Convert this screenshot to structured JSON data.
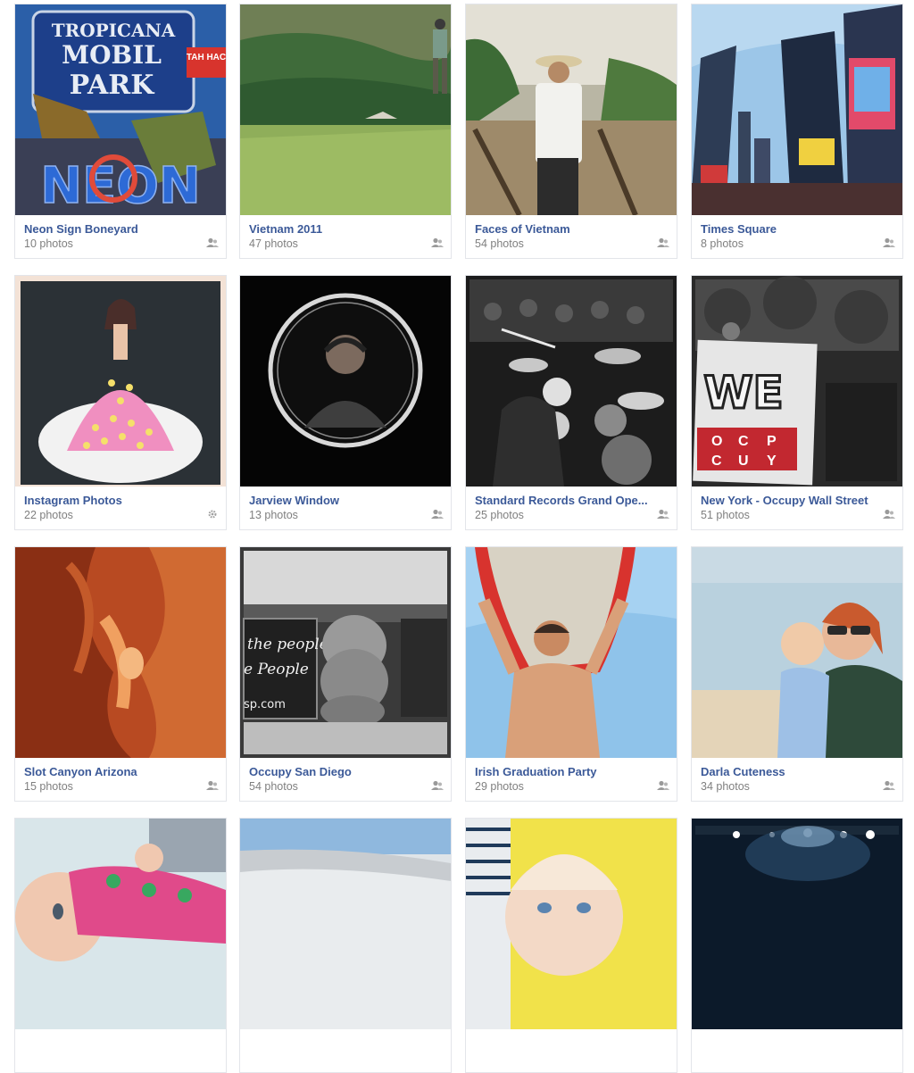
{
  "albums": [
    {
      "title": "Neon Sign Boneyard",
      "count": "10 photos",
      "privacy_icon": "friends-icon",
      "sign_lines": [
        "TROPICANA",
        "MOBIL",
        "PARK"
      ],
      "neon_word": "NEON",
      "side_sign": "TAH HAC"
    },
    {
      "title": "Vietnam 2011",
      "count": "47 photos",
      "privacy_icon": "friends-icon"
    },
    {
      "title": "Faces of Vietnam",
      "count": "54 photos",
      "privacy_icon": "friends-icon"
    },
    {
      "title": "Times Square",
      "count": "8 photos",
      "privacy_icon": "friends-icon"
    },
    {
      "title": "Instagram Photos",
      "count": "22 photos",
      "privacy_icon": "gear-icon"
    },
    {
      "title": "Jarview Window",
      "count": "13 photos",
      "privacy_icon": "friends-icon"
    },
    {
      "title": "Standard Records Grand Ope...",
      "count": "25 photos",
      "privacy_icon": "friends-icon"
    },
    {
      "title": "New York - Occupy Wall Street",
      "count": "51 photos",
      "privacy_icon": "friends-icon",
      "banner_word": "WE",
      "banner_letters": [
        "O",
        "C",
        "P",
        "C",
        "U",
        "Y"
      ]
    },
    {
      "title": "Slot Canyon Arizona",
      "count": "15 photos",
      "privacy_icon": "friends-icon"
    },
    {
      "title": "Occupy San Diego",
      "count": "54 photos",
      "privacy_icon": "friends-icon",
      "sign_lines": [
        "the people",
        "e People",
        "sp.com"
      ]
    },
    {
      "title": "Irish Graduation Party",
      "count": "29 photos",
      "privacy_icon": "friends-icon"
    },
    {
      "title": "Darla Cuteness",
      "count": "34 photos",
      "privacy_icon": "friends-icon"
    },
    {
      "title": "",
      "count": "",
      "privacy_icon": ""
    },
    {
      "title": "",
      "count": "",
      "privacy_icon": ""
    },
    {
      "title": "",
      "count": "",
      "privacy_icon": ""
    },
    {
      "title": "",
      "count": "",
      "privacy_icon": ""
    }
  ],
  "colors": {
    "link": "#3b5998",
    "muted": "#7f7f7f",
    "border": "#e3e5ea"
  }
}
